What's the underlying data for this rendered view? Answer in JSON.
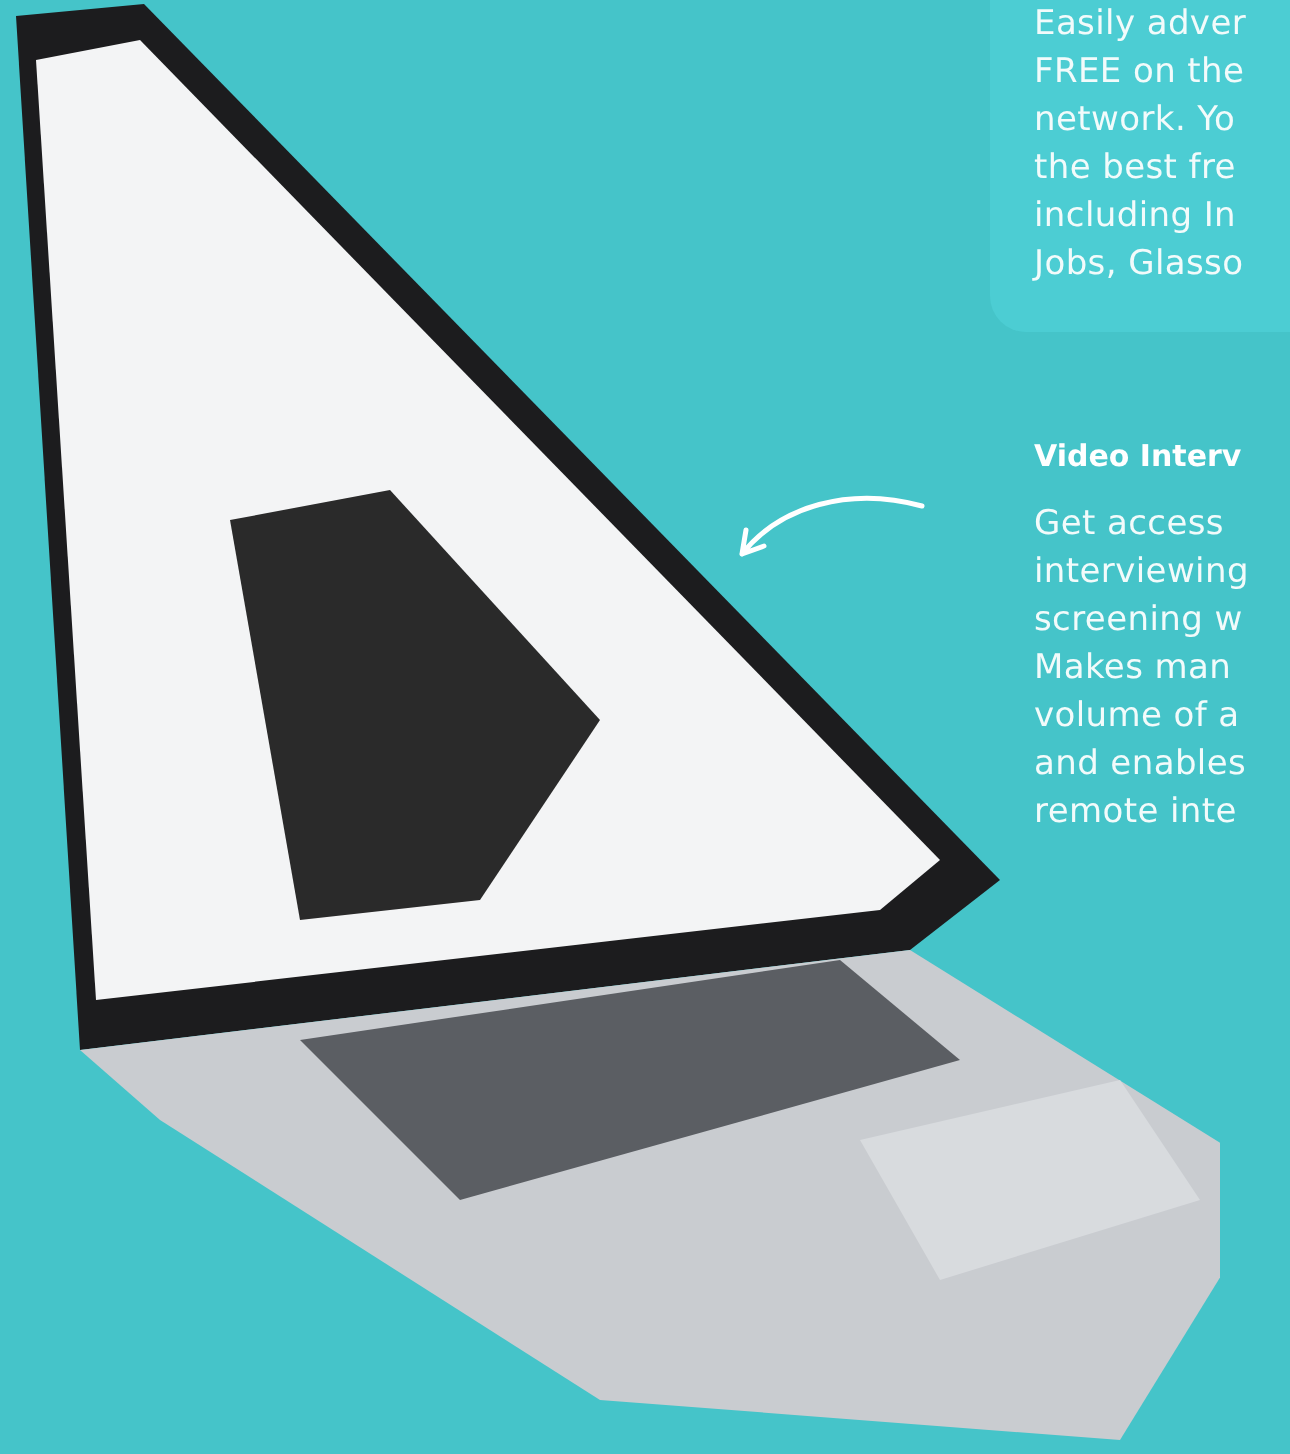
{
  "features": [
    {
      "kind": "card",
      "lines": [
        "Easily adver",
        "FREE on the",
        "network. Yo",
        "the best fre",
        "including In",
        "Jobs, Glasso"
      ]
    },
    {
      "kind": "plain",
      "heading": "Video Interv",
      "lines": [
        "Get access",
        "interviewing",
        "screening w",
        "Makes man",
        "volume of a",
        "and enables",
        "remote inte"
      ]
    }
  ]
}
